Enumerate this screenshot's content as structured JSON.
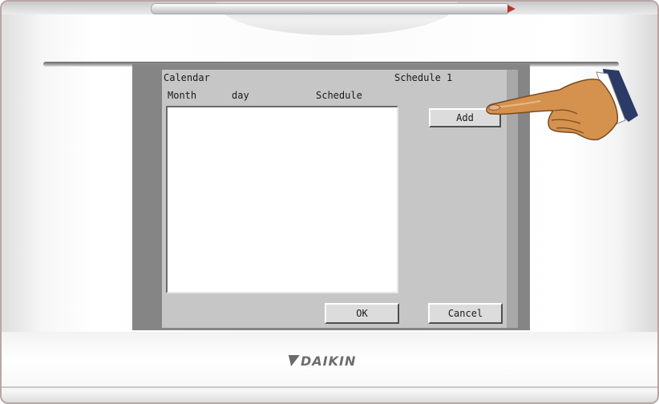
{
  "screen": {
    "title": "Calendar",
    "schedule_name": "Schedule 1",
    "columns": [
      "Month",
      "day",
      "Schedule"
    ],
    "rows": []
  },
  "buttons": {
    "add": "Add",
    "ok": "OK",
    "cancel": "Cancel"
  },
  "brand": {
    "logo_text": "DAIKIN"
  },
  "pointer": {
    "icon": "pointing-hand-icon",
    "target": "add"
  }
}
